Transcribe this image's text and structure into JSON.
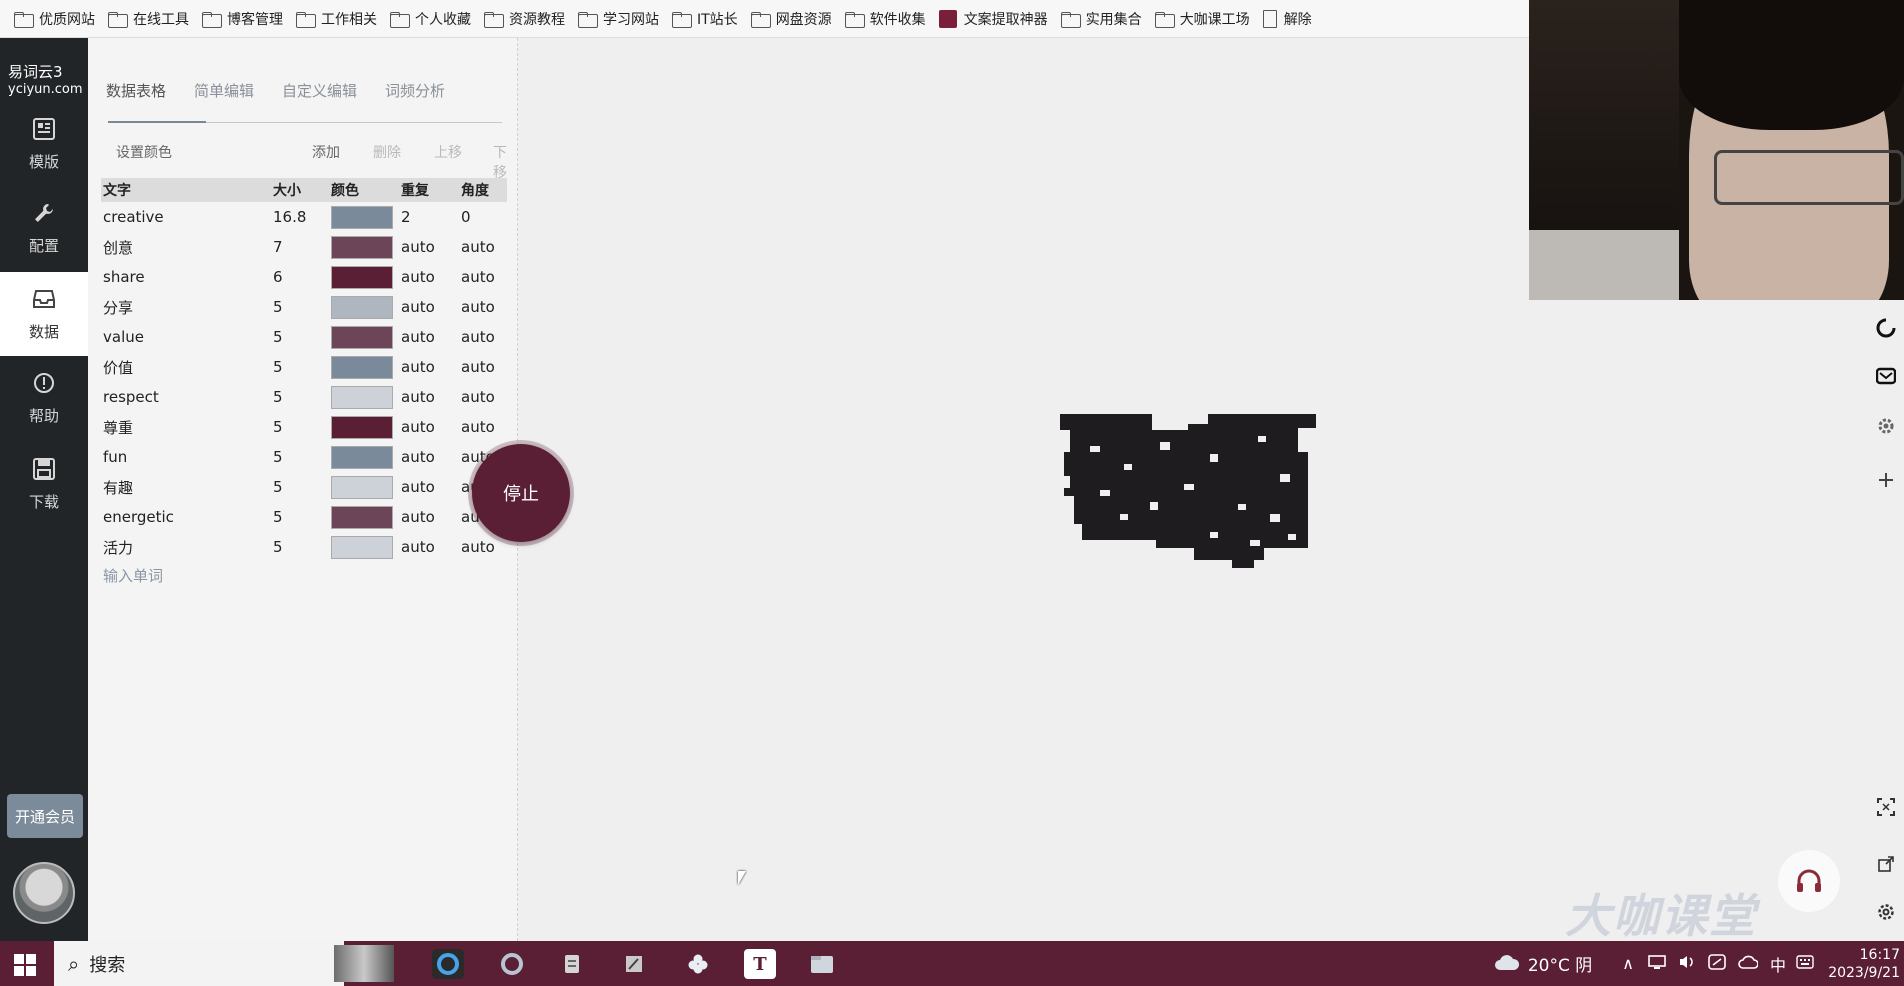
{
  "bookmarks": [
    {
      "label": "优质网站",
      "icon": "folder-icon"
    },
    {
      "label": "在线工具",
      "icon": "folder-icon"
    },
    {
      "label": "博客管理",
      "icon": "folder-icon"
    },
    {
      "label": "工作相关",
      "icon": "folder-icon"
    },
    {
      "label": "个人收藏",
      "icon": "folder-icon"
    },
    {
      "label": "资源教程",
      "icon": "folder-icon"
    },
    {
      "label": "学习网站",
      "icon": "folder-icon"
    },
    {
      "label": "IT站长",
      "icon": "folder-icon"
    },
    {
      "label": "网盘资源",
      "icon": "folder-icon"
    },
    {
      "label": "软件收集",
      "icon": "folder-icon"
    },
    {
      "label": "文案提取神器",
      "icon": "app-icon"
    },
    {
      "label": "实用集合",
      "icon": "folder-icon"
    },
    {
      "label": "大咖课工场",
      "icon": "folder-icon"
    },
    {
      "label": "解除",
      "icon": "document-icon"
    }
  ],
  "app": {
    "brand_name": "易词云3",
    "brand_url": "yciyun.com"
  },
  "nav": {
    "template": "模版",
    "config": "配置",
    "data": "数据",
    "help": "帮助",
    "download": "下载",
    "vip": "开通会员"
  },
  "tabs": [
    "数据表格",
    "简单编辑",
    "自定义编辑",
    "词频分析"
  ],
  "toolbar": {
    "set_color": "设置颜色",
    "add": "添加",
    "delete": "删除",
    "move_up": "上移",
    "move_down": "下移"
  },
  "table": {
    "headers": [
      "文字",
      "大小",
      "颜色",
      "重复",
      "角度"
    ],
    "rows": [
      {
        "word": "creative",
        "size": "16.8",
        "color": "#7b8a9a",
        "repeat": "2",
        "angle": "0"
      },
      {
        "word": "创意",
        "size": "7",
        "color": "#6d4558",
        "repeat": "auto",
        "angle": "auto"
      },
      {
        "word": "share",
        "size": "6",
        "color": "#5a1f34",
        "repeat": "auto",
        "angle": "auto"
      },
      {
        "word": "分享",
        "size": "5",
        "color": "#aeb6c0",
        "repeat": "auto",
        "angle": "auto"
      },
      {
        "word": "value",
        "size": "5",
        "color": "#6d4558",
        "repeat": "auto",
        "angle": "auto"
      },
      {
        "word": "价值",
        "size": "5",
        "color": "#7b8a9a",
        "repeat": "auto",
        "angle": "auto"
      },
      {
        "word": "respect",
        "size": "5",
        "color": "#cdd2d9",
        "repeat": "auto",
        "angle": "auto"
      },
      {
        "word": "尊重",
        "size": "5",
        "color": "#5a1f34",
        "repeat": "auto",
        "angle": "auto"
      },
      {
        "word": "fun",
        "size": "5",
        "color": "#7b8a9a",
        "repeat": "auto",
        "angle": "auto"
      },
      {
        "word": "有趣",
        "size": "5",
        "color": "#cdd2d9",
        "repeat": "auto",
        "angle": "auto"
      },
      {
        "word": "energetic",
        "size": "5",
        "color": "#6d4558",
        "repeat": "auto",
        "angle": "auto"
      },
      {
        "word": "活力",
        "size": "5",
        "color": "#cdd2d9",
        "repeat": "auto",
        "angle": "auto"
      }
    ],
    "add_word_placeholder": "输入单词"
  },
  "stop_button": "停止",
  "watermark": "大咖课堂",
  "taskbar": {
    "search": "搜索",
    "weather": "20°C 阴",
    "ime": "中",
    "time": "16:17",
    "date": "2023/9/21"
  },
  "colors": {
    "accent": "#5b1f35",
    "nav_bg": "#222528"
  }
}
